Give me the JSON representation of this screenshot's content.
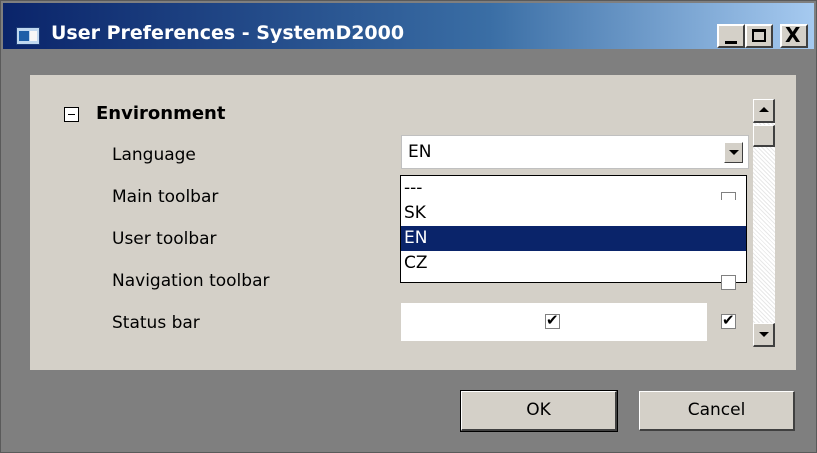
{
  "window": {
    "title": "User Preferences - SystemD2000",
    "controls": {
      "minimize": "minimize-icon",
      "maximize": "maximize-icon",
      "close": "close-icon",
      "close_glyph": "X"
    }
  },
  "section": {
    "expander_icon": "collapse-icon",
    "title": "Environment",
    "properties": [
      {
        "label": "Language"
      },
      {
        "label": "Main toolbar"
      },
      {
        "label": "User toolbar"
      },
      {
        "label": "Navigation toolbar"
      },
      {
        "label": "Status bar"
      }
    ]
  },
  "language": {
    "selected": "EN",
    "options": [
      "---",
      "SK",
      "EN",
      "CZ"
    ]
  },
  "status_bar": {
    "checked": true,
    "check_glyph": "✔"
  },
  "right_column_checks": {
    "check_glyph": "✔"
  },
  "buttons": {
    "ok": "OK",
    "cancel": "Cancel"
  },
  "colors": {
    "title_bar_start": "#0a246a",
    "title_bar_end": "#a6caf0",
    "selection": "#0a246a",
    "face": "#d4d0c8"
  }
}
